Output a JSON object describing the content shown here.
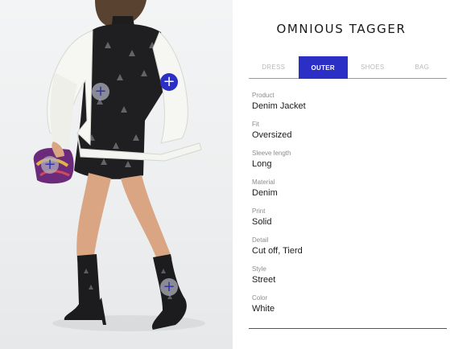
{
  "app": {
    "brand": "OMNIOUS TAGGER"
  },
  "tabs": [
    {
      "label": "DRESS",
      "active": false
    },
    {
      "label": "OUTER",
      "active": true
    },
    {
      "label": "SHOES",
      "active": false
    },
    {
      "label": "BAG",
      "active": false
    }
  ],
  "attributes": [
    {
      "label": "Product",
      "value": "Denim Jacket"
    },
    {
      "label": "Fit",
      "value": "Oversized"
    },
    {
      "label": "Sleeve length",
      "value": "Long"
    },
    {
      "label": "Material",
      "value": "Denim"
    },
    {
      "label": "Print",
      "value": "Solid"
    },
    {
      "label": "Detail",
      "value": "Cut off, Tierd"
    },
    {
      "label": "Style",
      "value": "Street"
    },
    {
      "label": "Color",
      "value": "White"
    }
  ],
  "hotspots": [
    {
      "item": "dress",
      "symbol": "+",
      "active": false
    },
    {
      "item": "outer",
      "symbol": "+",
      "active": true
    },
    {
      "item": "bag",
      "symbol": "+",
      "active": false
    },
    {
      "item": "shoes",
      "symbol": "+",
      "active": false
    }
  ],
  "colors": {
    "accent": "#2c2fc6",
    "inactive_tab": "#b9b9b9"
  }
}
